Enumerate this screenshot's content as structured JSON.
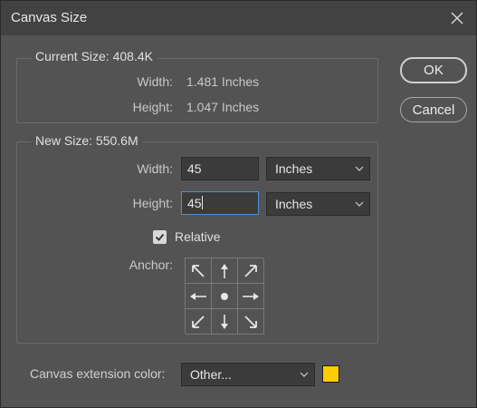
{
  "window": {
    "title": "Canvas Size"
  },
  "current_size": {
    "label": "Current Size: 408.4K",
    "width_label": "Width:",
    "width_value": "1.481 Inches",
    "height_label": "Height:",
    "height_value": "1.047 Inches"
  },
  "new_size": {
    "label": "New Size: 550.6M",
    "width_label": "Width:",
    "width_value": "45",
    "width_unit": "Inches",
    "height_label": "Height:",
    "height_value": "45",
    "height_unit": "Inches",
    "relative_label": "Relative",
    "relative_checked": true,
    "anchor_label": "Anchor:"
  },
  "buttons": {
    "ok": "OK",
    "cancel": "Cancel"
  },
  "extension": {
    "label": "Canvas extension color:",
    "value": "Other...",
    "swatch_color": "#ffcc00"
  },
  "icons": {
    "close": "close-icon",
    "chevron": "chevron-down-icon",
    "check": "check-icon",
    "anchor_arrows": [
      "arrow-nw-icon",
      "arrow-n-icon",
      "arrow-ne-icon",
      "arrow-w-icon",
      "anchor-center-dot",
      "arrow-e-icon",
      "arrow-sw-icon",
      "arrow-s-icon",
      "arrow-se-icon"
    ]
  }
}
